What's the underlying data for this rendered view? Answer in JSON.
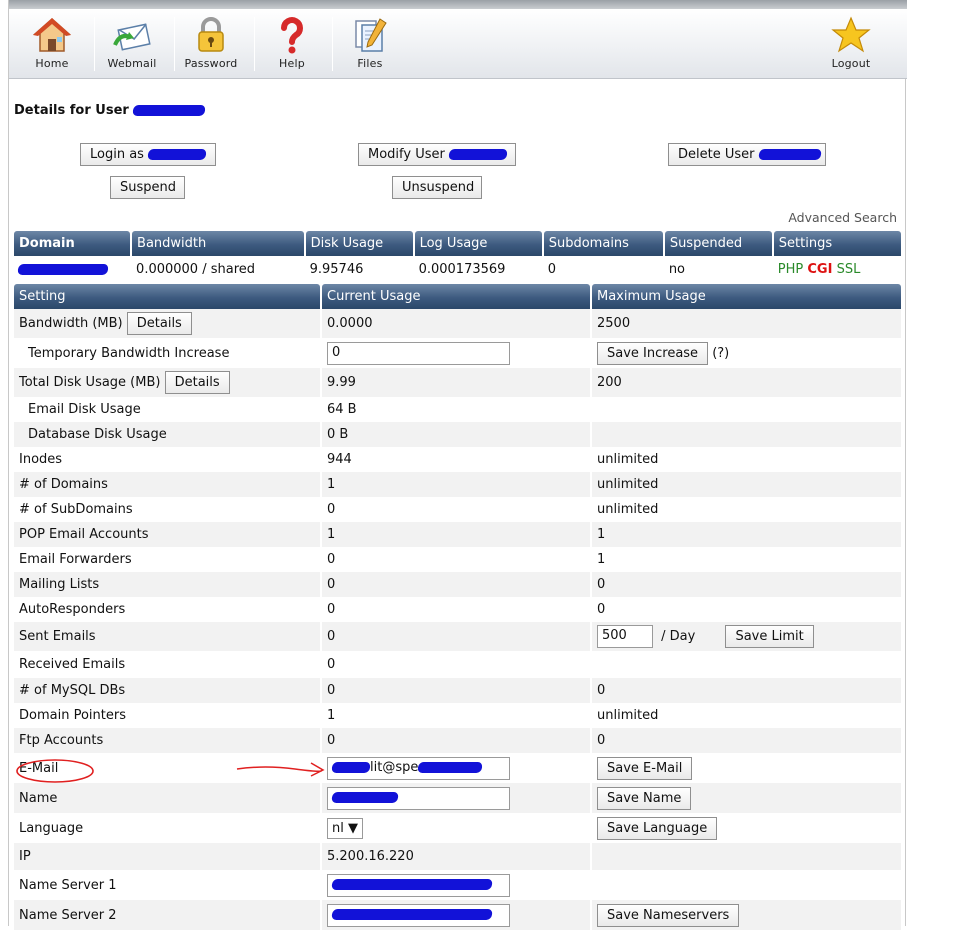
{
  "toolbar": {
    "items": [
      {
        "label": "Home",
        "icon": "home-icon"
      },
      {
        "label": "Webmail",
        "icon": "webmail-icon"
      },
      {
        "label": "Password",
        "icon": "lock-icon"
      },
      {
        "label": "Help",
        "icon": "help-icon"
      },
      {
        "label": "Files",
        "icon": "files-icon"
      }
    ],
    "logout": {
      "label": "Logout",
      "icon": "star-icon"
    }
  },
  "details_title": "Details for User",
  "actions": {
    "login_as": "Login as",
    "modify_user": "Modify User",
    "delete_user": "Delete User",
    "suspend": "Suspend",
    "unsuspend": "Unsuspend"
  },
  "advanced_search": "Advanced Search",
  "domain_table": {
    "headers": [
      "Domain",
      "Bandwidth",
      "Disk Usage",
      "Log Usage",
      "Subdomains",
      "Suspended",
      "Settings"
    ],
    "row": {
      "bandwidth": "0.000000 / shared",
      "disk_usage": "9.95746",
      "log_usage": "0.000173569",
      "subdomains": "0",
      "suspended": "no",
      "settings_php": "PHP",
      "settings_cgi": "CGI",
      "settings_ssl": "SSL"
    }
  },
  "settings_table": {
    "headers": [
      "Setting",
      "Current Usage",
      "Maximum Usage"
    ],
    "bandwidth": {
      "label": "Bandwidth (MB)",
      "details": "Details",
      "current": "0.0000",
      "max": "2500"
    },
    "temp_bandwidth": {
      "label": "Temporary Bandwidth Increase",
      "value": "0",
      "button": "Save Increase",
      "help": "(?)"
    },
    "total_disk": {
      "label": "Total Disk Usage (MB)",
      "details": "Details",
      "current": "9.99",
      "max": "200"
    },
    "email_disk": {
      "label": "Email Disk Usage",
      "current": "64 B"
    },
    "db_disk": {
      "label": "Database Disk Usage",
      "current": "0 B"
    },
    "inodes": {
      "label": "Inodes",
      "current": "944",
      "max": "unlimited"
    },
    "domains": {
      "label": "# of Domains",
      "current": "1",
      "max": "unlimited"
    },
    "subdomains": {
      "label": "# of SubDomains",
      "current": "0",
      "max": "unlimited"
    },
    "pop": {
      "label": "POP Email Accounts",
      "current": "1",
      "max": "1"
    },
    "forwarders": {
      "label": "Email Forwarders",
      "current": "0",
      "max": "1"
    },
    "mailing": {
      "label": "Mailing Lists",
      "current": "0",
      "max": "0"
    },
    "autoresponders": {
      "label": "AutoResponders",
      "current": "0",
      "max": "0"
    },
    "sent": {
      "label": "Sent Emails",
      "current": "0",
      "limit": "500",
      "per_day": "/ Day",
      "button": "Save Limit"
    },
    "received": {
      "label": "Received Emails",
      "current": "0"
    },
    "mysql": {
      "label": "# of MySQL DBs",
      "current": "0",
      "max": "0"
    },
    "pointers": {
      "label": "Domain Pointers",
      "current": "1",
      "max": "unlimited"
    },
    "ftp": {
      "label": "Ftp Accounts",
      "current": "0",
      "max": "0"
    },
    "email": {
      "label": "E-Mail",
      "value_visible": "lit@spe",
      "button": "Save E-Mail"
    },
    "name": {
      "label": "Name",
      "button": "Save Name"
    },
    "language": {
      "label": "Language",
      "value": "nl",
      "button": "Save Language"
    },
    "ip": {
      "label": "IP",
      "current": "5.200.16.220"
    },
    "ns1": {
      "label": "Name Server 1"
    },
    "ns2": {
      "label": "Name Server 2",
      "button": "Save Nameservers"
    }
  },
  "colors": {
    "header": "#3d5a7f",
    "redaction": "#1212d8",
    "annotation": "#e02020"
  }
}
